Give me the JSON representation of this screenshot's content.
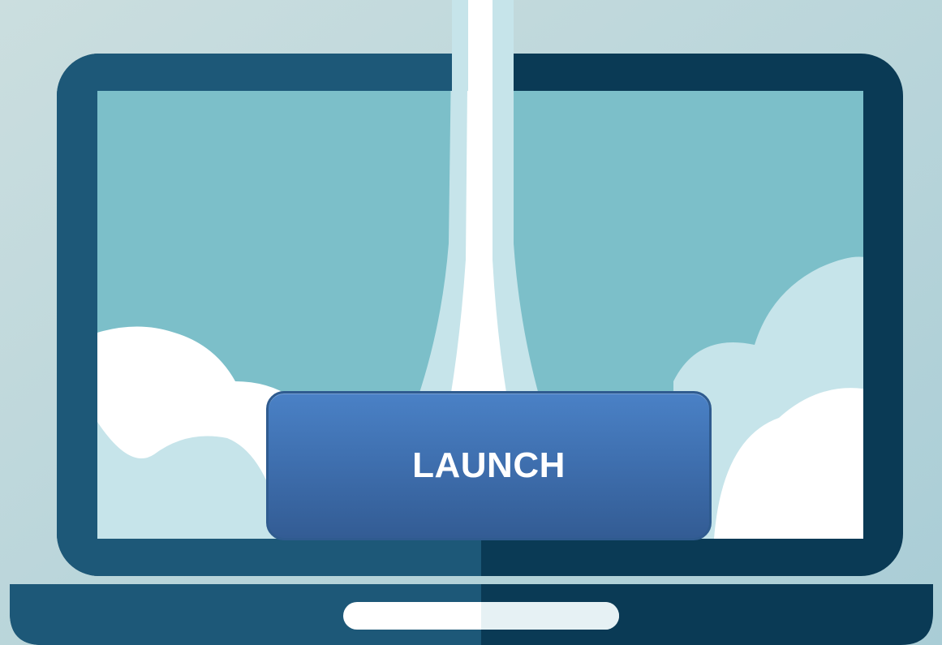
{
  "launch_button": {
    "label": "LAUNCH"
  },
  "icons": {
    "laptop": "laptop-icon",
    "rocket_trail": "rocket-trail-icon",
    "clouds": "cloud-icon"
  },
  "colors": {
    "background": "#c8dcdf",
    "laptop_frame_light": "#1d5878",
    "laptop_frame_dark": "#0a3a55",
    "screen": "#7cbfc9",
    "cloud_white": "#ffffff",
    "cloud_pale": "#c6e4ea",
    "button_top": "#4a81c6",
    "button_bottom": "#335c94",
    "button_text": "#ffffff"
  }
}
